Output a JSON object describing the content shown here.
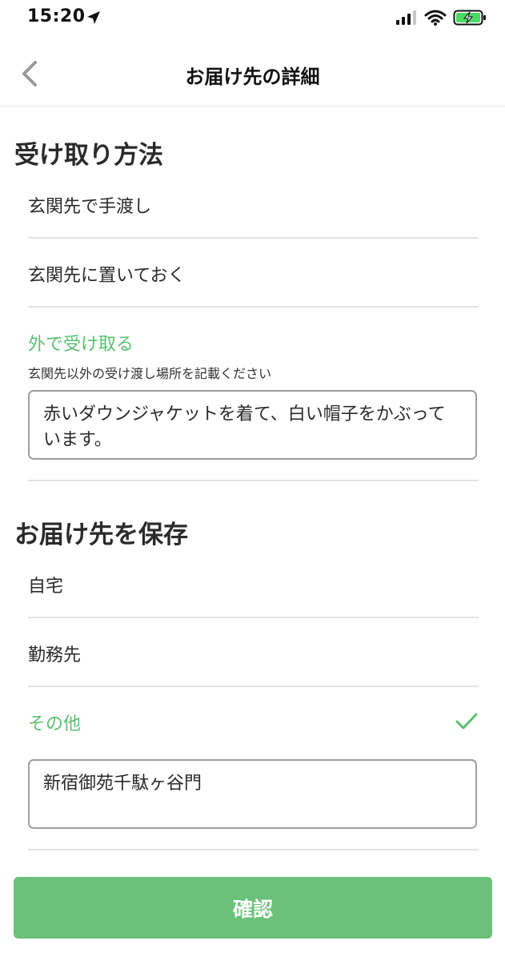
{
  "status_bar": {
    "time": "15:20",
    "icons": [
      "location-arrow-icon",
      "cellular-signal-icon",
      "wifi-icon",
      "battery-charging-icon"
    ]
  },
  "nav": {
    "title": "お届け先の詳細",
    "back_icon": "chevron-left-icon"
  },
  "receive_method": {
    "title": "受け取り方法",
    "options": [
      {
        "label": "玄関先で手渡し",
        "selected": false
      },
      {
        "label": "玄関先に置いておく",
        "selected": false
      },
      {
        "label": "外で受け取る",
        "selected": true
      }
    ],
    "hint": "玄関先以外の受け渡し場所を記載ください",
    "note_value": "赤いダウンジャケットを着て、白い帽子をかぶっています。"
  },
  "save_destination": {
    "title": "お届け先を保存",
    "options": [
      {
        "label": "自宅",
        "selected": false
      },
      {
        "label": "勤務先",
        "selected": false
      },
      {
        "label": "その他",
        "selected": true
      }
    ],
    "other_value": "新宿御苑千駄ヶ谷門",
    "check_icon": "checkmark-icon"
  },
  "confirm_label": "確認",
  "colors": {
    "accent": "#5bbf6f",
    "button": "#6bc17a",
    "text": "#2a2a2a",
    "divider": "#e3e3e3"
  }
}
